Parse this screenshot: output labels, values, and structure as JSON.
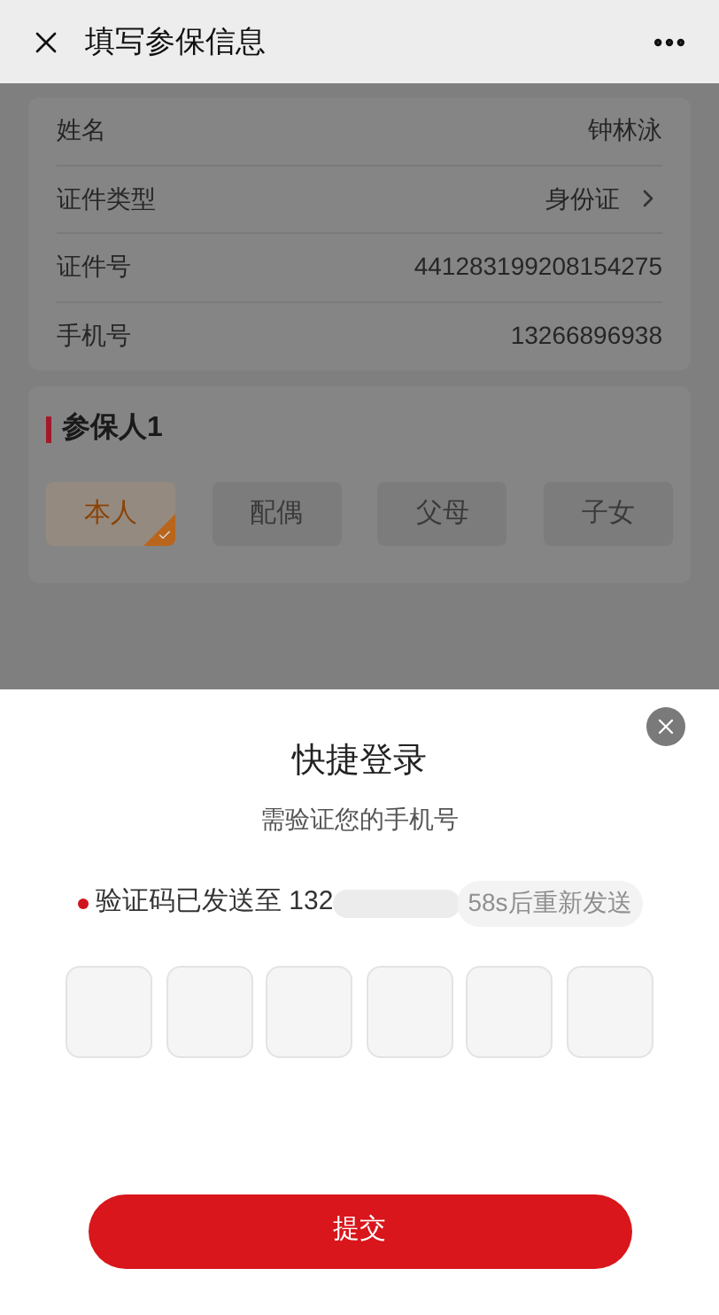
{
  "header": {
    "title": "填写参保信息"
  },
  "info_rows": [
    {
      "label": "姓名",
      "value": "钟林泳",
      "kind": "text"
    },
    {
      "label": "证件类型",
      "value": "身份证",
      "kind": "select"
    },
    {
      "label": "证件号",
      "value": "441283199208154275",
      "kind": "text"
    },
    {
      "label": "手机号",
      "value": "13266896938",
      "kind": "text"
    }
  ],
  "insured": {
    "title": "参保人1",
    "relations": [
      {
        "label": "本人",
        "selected": true
      },
      {
        "label": "配偶",
        "selected": false
      },
      {
        "label": "父母",
        "selected": false
      },
      {
        "label": "子女",
        "selected": false
      }
    ]
  },
  "login_sheet": {
    "title": "快捷登录",
    "subtitle": "需验证您的手机号",
    "sent_text": "验证码已发送至 132",
    "resend": {
      "label": "58s后重新发送",
      "disabled": true
    },
    "submit": "提交"
  }
}
